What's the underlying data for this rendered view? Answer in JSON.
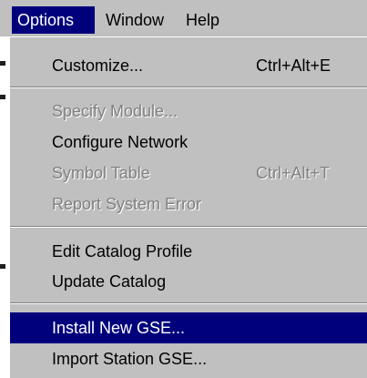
{
  "menubar": {
    "items": [
      {
        "label": "Options",
        "active": true
      },
      {
        "label": "Window",
        "active": false
      },
      {
        "label": "Help",
        "active": false
      }
    ]
  },
  "menu": {
    "items": [
      {
        "label": "Customize...",
        "shortcut": "Ctrl+Alt+E",
        "enabled": true,
        "highlighted": false
      },
      {
        "label": "Specify Module...",
        "shortcut": "",
        "enabled": false,
        "highlighted": false
      },
      {
        "label": "Configure Network",
        "shortcut": "",
        "enabled": true,
        "highlighted": false
      },
      {
        "label": "Symbol Table",
        "shortcut": "Ctrl+Alt+T",
        "enabled": false,
        "highlighted": false
      },
      {
        "label": "Report System Error",
        "shortcut": "",
        "enabled": false,
        "highlighted": false
      },
      {
        "label": "Edit Catalog Profile",
        "shortcut": "",
        "enabled": true,
        "highlighted": false
      },
      {
        "label": "Update Catalog",
        "shortcut": "",
        "enabled": true,
        "highlighted": false
      },
      {
        "label": "Install New GSE...",
        "shortcut": "",
        "enabled": true,
        "highlighted": true
      },
      {
        "label": "Import Station GSE...",
        "shortcut": "",
        "enabled": true,
        "highlighted": false
      }
    ]
  },
  "colors": {
    "menu_background": "#c0c0c0",
    "highlight": "#00007c",
    "highlight_text": "#ffffff",
    "disabled_text": "#808080"
  }
}
